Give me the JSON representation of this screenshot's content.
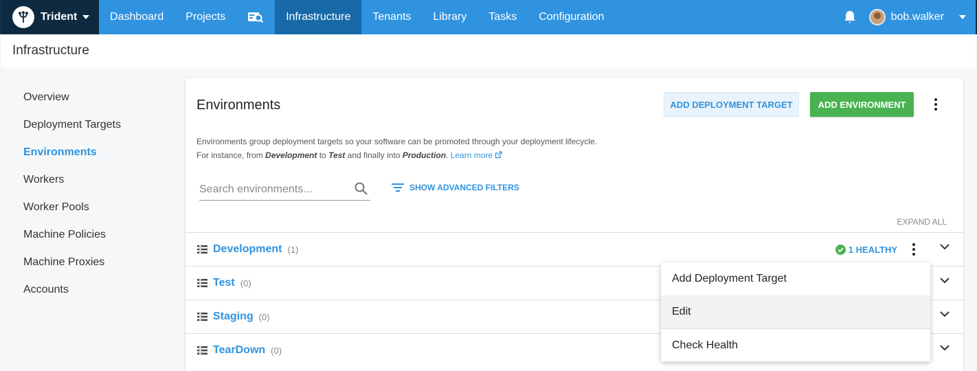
{
  "nav": {
    "brand": "Trident",
    "items": [
      "Dashboard",
      "Projects",
      "",
      "Infrastructure",
      "Tenants",
      "Library",
      "Tasks",
      "Configuration"
    ],
    "active_index": 3,
    "user": "bob.walker"
  },
  "page": {
    "title": "Infrastructure"
  },
  "sidebar": {
    "items": [
      {
        "label": "Overview"
      },
      {
        "label": "Deployment Targets"
      },
      {
        "label": "Environments"
      },
      {
        "label": "Workers"
      },
      {
        "label": "Worker Pools"
      },
      {
        "label": "Machine Policies"
      },
      {
        "label": "Machine Proxies"
      },
      {
        "label": "Accounts"
      }
    ],
    "active": "Environments"
  },
  "main": {
    "title": "Environments",
    "add_target_label": "ADD DEPLOYMENT TARGET",
    "add_env_label": "ADD ENVIRONMENT",
    "desc_line1": "Environments group deployment targets so your software can be promoted through your deployment lifecycle.",
    "desc_for": "For instance, from ",
    "desc_dev": "Development",
    "desc_to": " to ",
    "desc_test": "Test",
    "desc_and": " and finally into ",
    "desc_prod": "Production",
    "desc_dot": ". ",
    "learn_more": "Learn more",
    "search_placeholder": "Search environments...",
    "advanced_filters": "SHOW ADVANCED FILTERS",
    "expand_all": "EXPAND ALL",
    "environments": [
      {
        "name": "Development",
        "count": "(1)",
        "health": "1 HEALTHY"
      },
      {
        "name": "Test",
        "count": "(0)"
      },
      {
        "name": "Staging",
        "count": "(0)"
      },
      {
        "name": "TearDown",
        "count": "(0)"
      }
    ]
  },
  "menu": {
    "items": [
      "Add Deployment Target",
      "Edit",
      "Check Health"
    ]
  },
  "colors": {
    "accent": "#2f93e0",
    "brand_bg": "#0d2a40",
    "active_nav": "#1869a8",
    "success": "#48b350"
  }
}
